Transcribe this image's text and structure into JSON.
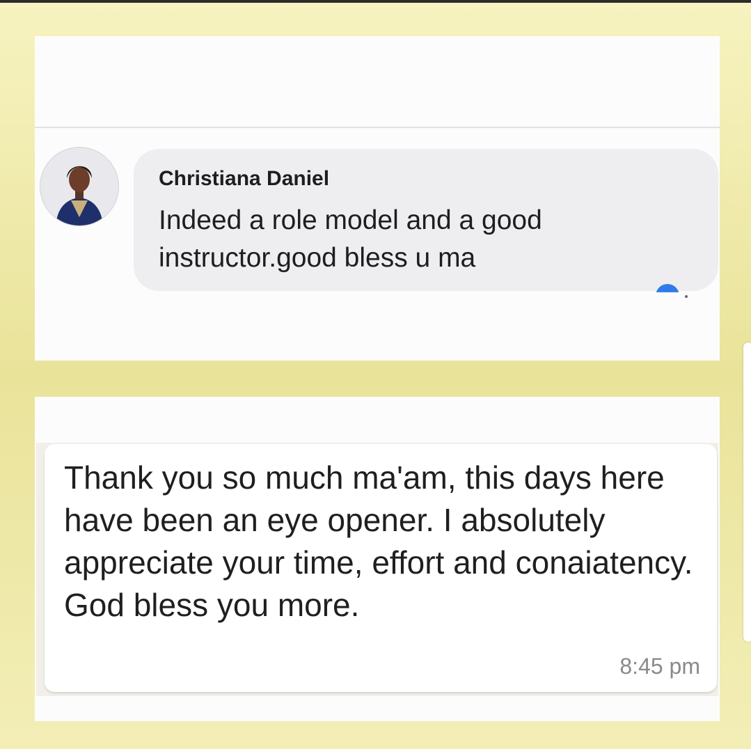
{
  "comment": {
    "author": "Christiana Daniel",
    "text": "Indeed a role model and a good instructor.good bless u ma",
    "avatar_icon": "profile-photo",
    "reaction_icon": "like-reaction-icon"
  },
  "message": {
    "text": "Thank you so much ma'am, this days here have been an eye opener. I absolutely appreciate your time, effort and conaiatency. God bless you more.",
    "time": "8:45 pm"
  },
  "colors": {
    "frame_background": "#f3eeb6",
    "card_background": "#fdfcfd",
    "comment_bubble": "#eeedf0",
    "like_blue": "#2f7be9",
    "timestamp_gray": "#8a8a8a"
  }
}
